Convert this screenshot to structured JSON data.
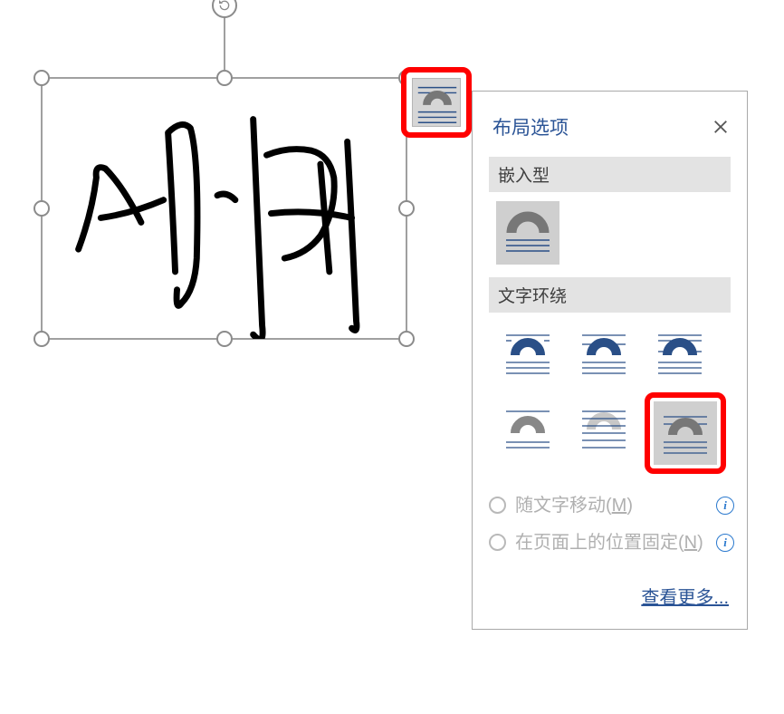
{
  "popup": {
    "title": "布局选项",
    "section_inline": "嵌入型",
    "section_wrap": "文字环绕",
    "radio_move_with_text": "随文字移动",
    "radio_move_with_text_key": "M",
    "radio_fixed": "在页面上的位置固定",
    "radio_fixed_key": "N",
    "see_more": "查看更多..."
  },
  "layout_options": {
    "inline": [
      {
        "name": "inline-with-text",
        "selected": true,
        "highlighted": false
      }
    ],
    "wrap_row1": [
      {
        "name": "square",
        "arc_front": true
      },
      {
        "name": "tight",
        "arc_front": true
      },
      {
        "name": "through",
        "arc_front": true
      }
    ],
    "wrap_row2": [
      {
        "name": "top-and-bottom",
        "arc_front": false
      },
      {
        "name": "behind-text",
        "arc_front": false
      },
      {
        "name": "in-front-of-text",
        "arc_front": false,
        "selected": true,
        "highlighted": true
      }
    ]
  },
  "image": {
    "description": "signature-handwriting"
  }
}
